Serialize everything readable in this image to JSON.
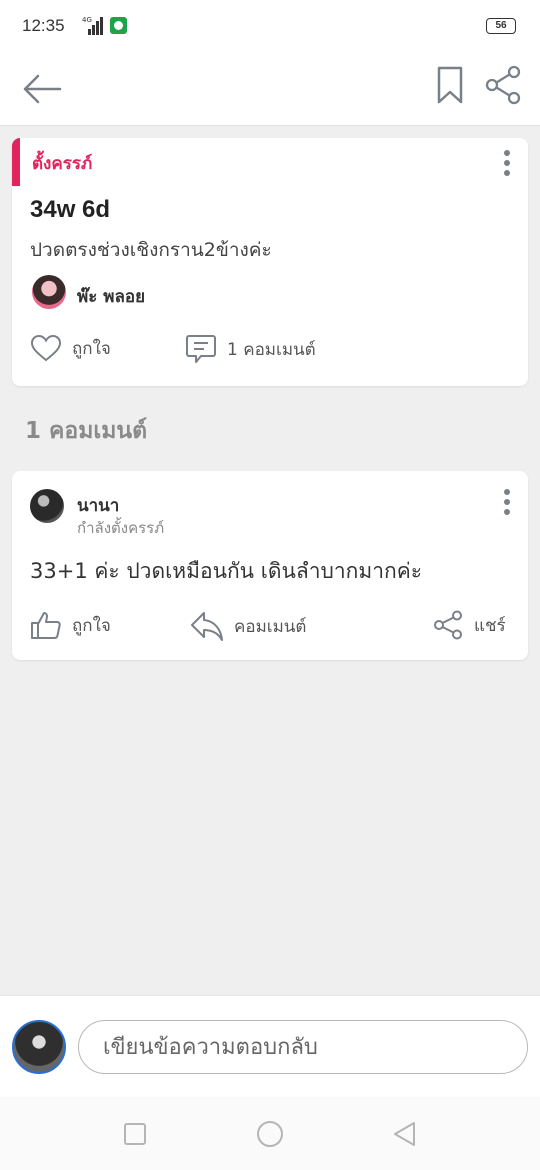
{
  "status_bar": {
    "time": "12:35",
    "network": "4G",
    "battery": "56"
  },
  "app_bar": {
    "back_icon": "arrow-left-icon",
    "bookmark_icon": "bookmark-icon",
    "share_icon": "share-icon"
  },
  "post": {
    "category": "ตั้งครรภ์",
    "title": "34w 6d",
    "body": "ปวดตรงช่วงเชิงกราน2ข้างค่ะ",
    "author": "พ๊ะ พลอย",
    "like_label": "ถูกใจ",
    "comment_label": "1 คอมเมนต์",
    "accent_color": "#e0245e"
  },
  "comments_section": {
    "title": "1 คอมเมนต์",
    "items": [
      {
        "name": "นานา",
        "status": "กำลังตั้งครรภ์",
        "body": "33+1 ค่ะ ปวดเหมือนกัน เดินลำบากมากค่ะ",
        "like_label": "ถูกใจ",
        "reply_label": "คอมเมนต์",
        "share_label": "แชร์"
      }
    ]
  },
  "composer": {
    "placeholder": "เขียนข้อความตอบกลับ"
  },
  "nav_bar": {
    "recent_icon": "square-icon",
    "home_icon": "circle-icon",
    "back_icon": "triangle-back-icon"
  }
}
